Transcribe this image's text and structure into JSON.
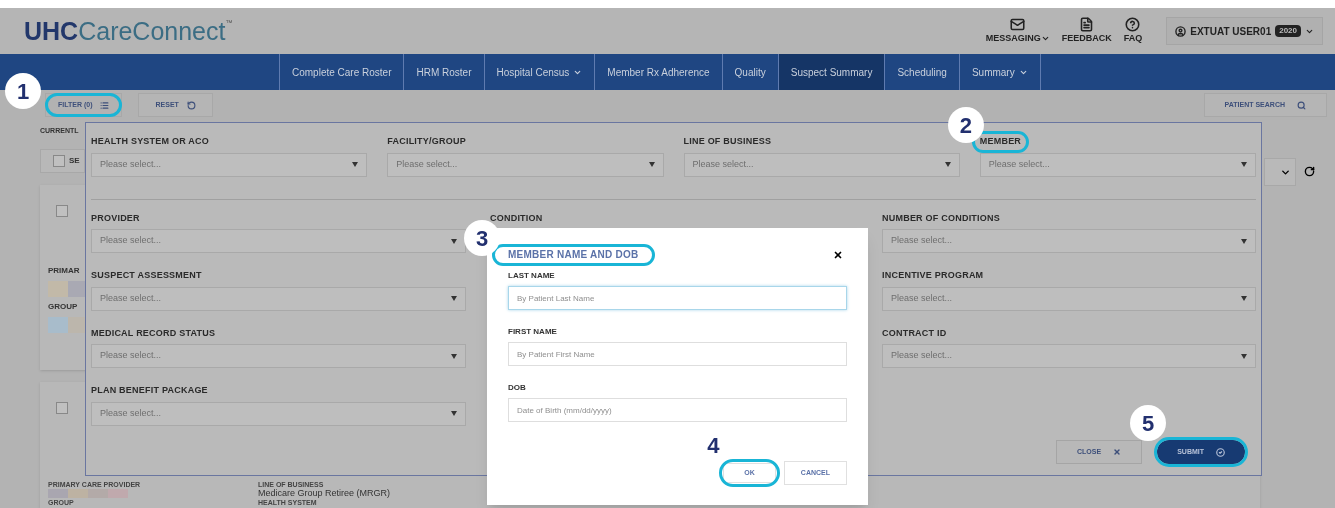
{
  "header": {
    "logo_bold": "UHC",
    "logo_light": "CareConnect",
    "trademark": "™"
  },
  "utility": [
    {
      "kind": "mail",
      "label": "MESSAGING",
      "has_menu": true
    },
    {
      "kind": "feedback",
      "label": "FEEDBACK",
      "has_menu": false
    },
    {
      "kind": "help",
      "label": "FAQ",
      "has_menu": false
    }
  ],
  "user": {
    "name": "EXTUAT USER01",
    "badge": "2020"
  },
  "nav": [
    {
      "label": "Complete Care Roster",
      "selected": false,
      "has_menu": false
    },
    {
      "label": "HRM Roster",
      "selected": false,
      "has_menu": false
    },
    {
      "label": "Hospital Census",
      "selected": false,
      "has_menu": true
    },
    {
      "label": "Member Rx Adherence",
      "selected": false,
      "has_menu": false
    },
    {
      "label": "Quality",
      "selected": false,
      "has_menu": false
    },
    {
      "label": "Suspect Summary",
      "selected": true,
      "has_menu": false
    },
    {
      "label": "Scheduling",
      "selected": false,
      "has_menu": false
    },
    {
      "label": "Summary",
      "selected": false,
      "has_menu": true
    }
  ],
  "toolbar": {
    "filter": {
      "label": "FILTER (0)",
      "callout": "1"
    },
    "reset": {
      "label": "RESET"
    },
    "patient_search": {
      "label": "PATIENT SEARCH"
    }
  },
  "background": {
    "current_label": "CURRENTL",
    "select_all": {
      "label": "SE",
      "checked": false
    },
    "cards": [
      {
        "checked": false,
        "labels": [
          "PRIMAR",
          "GROUP"
        ]
      },
      {
        "checked": false,
        "labels": [
          "PRIMARY CARE PROVIDER",
          "LINE OF BUSINESS"
        ],
        "line_of_business": "Medicare Group Retiree (MRGR)",
        "labels_2": [
          "GROUP",
          "HEALTH SYSTEM"
        ]
      }
    ]
  },
  "filter_panel": {
    "top_fields": [
      {
        "label": "HEALTH SYSTEM OR ACO",
        "placeholder": "Please select..."
      },
      {
        "label": "FACILITY/GROUP",
        "placeholder": "Please select..."
      },
      {
        "label": "LINE OF BUSINESS",
        "placeholder": "Please select..."
      },
      {
        "label": "MEMBER",
        "placeholder": "Please select...",
        "callout": "2"
      }
    ],
    "columns": [
      [
        {
          "label": "PROVIDER",
          "placeholder": "Please select..."
        },
        {
          "label": "SUSPECT ASSESSMENT",
          "placeholder": "Please select..."
        },
        {
          "label": "MEDICAL RECORD STATUS",
          "placeholder": "Please select..."
        },
        {
          "label": "PLAN BENEFIT PACKAGE",
          "placeholder": "Please select..."
        }
      ],
      [
        {
          "label": "CONDITION"
        }
      ],
      [
        {
          "label": "NUMBER OF CONDITIONS",
          "placeholder": "Please select..."
        },
        {
          "label": "INCENTIVE PROGRAM",
          "placeholder": "Please select..."
        },
        {
          "label": "CONTRACT ID",
          "placeholder": "Please select..."
        }
      ]
    ],
    "close": {
      "label": "CLOSE"
    },
    "submit": {
      "label": "SUBMIT",
      "callout": "5"
    }
  },
  "modal": {
    "title": "MEMBER NAME AND DOB",
    "title_callout": "3",
    "fields": [
      {
        "label": "LAST NAME",
        "placeholder": "By Patient Last Name",
        "focused": true
      },
      {
        "label": "FIRST NAME",
        "placeholder": "By Patient First Name",
        "focused": false
      },
      {
        "label": "DOB",
        "placeholder": "Date of Birth (mm/dd/yyyy)",
        "focused": false
      }
    ],
    "ok": {
      "label": "OK",
      "callout": "4"
    },
    "cancel": {
      "label": "CANCEL"
    }
  }
}
